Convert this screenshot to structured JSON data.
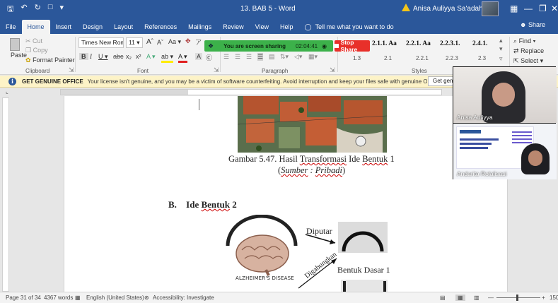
{
  "titlebar": {
    "doc_title": "13. BAB 5  -  Word",
    "user_name": "Anisa Auliyya Sa'adah",
    "qat": [
      "save-icon",
      "undo-icon",
      "redo-icon",
      "new-doc-icon",
      "qat-more-icon"
    ],
    "minimize": "—",
    "restore": "❐",
    "close": "✕"
  },
  "tabs": [
    "File",
    "Home",
    "Insert",
    "Design",
    "Layout",
    "References",
    "Mailings",
    "Review",
    "View",
    "Help"
  ],
  "active_tab": "Home",
  "tell_me": "Tell me what you want to do",
  "share_label": "Share",
  "clipboard": {
    "paste": "Paste",
    "cut": "Cut",
    "copy": "Copy",
    "format_painter": "Format Painter",
    "group_label": "Clipboard"
  },
  "font": {
    "name": "Times New Roma",
    "size": "11",
    "group_label": "Font"
  },
  "paragraph": {
    "group_label": "Paragraph"
  },
  "styles": {
    "group_label": "Styles",
    "items": [
      {
        "sample": "2.1.1. Aa",
        "name": "1.3"
      },
      {
        "sample": "2.2.1. Aa",
        "name": "2.1"
      },
      {
        "sample": "2.2.3.1.",
        "name": "2.2.1"
      },
      {
        "sample": "2.4.1.",
        "name": "2.2.3"
      },
      {
        "sample": "",
        "name": "2.3"
      }
    ]
  },
  "editing": {
    "find": "Find",
    "replace": "Replace",
    "select": "Select"
  },
  "screenshare": {
    "message": "You are screen sharing",
    "timer": "02:04:41",
    "stop": "Stop Share"
  },
  "banner": {
    "title": "GET GENUINE OFFICE",
    "message": "Your license isn't genuine, and you may be a victim of software counterfeiting. Avoid interruption and keep your files safe with genuine Office today.",
    "button": "Get genu"
  },
  "document": {
    "caption_prefix": "Gambar 5.47. Hasil ",
    "caption_word1": "Transformasi",
    "caption_mid": " Ide ",
    "caption_word2": "Bentuk",
    "caption_suffix": " 1",
    "source_open": "(",
    "source_word1": "Sumber",
    "source_mid": " : ",
    "source_word2": "Pribadi",
    "source_close": ")",
    "heading_letter": "B.",
    "heading_prefix": "Ide ",
    "heading_word": "Bentuk",
    "heading_suffix": " 2",
    "diagram_label_rotated": "Diputar",
    "diagram_label_tilted": "Digabungkan",
    "diagram_brain_caption": "ALZHEIMER'S DISEASE",
    "diagram_shape_label": "Bentuk Dasar 1"
  },
  "status": {
    "page": "Page 31 of 34",
    "words": "4367 words",
    "language": "English (United States)",
    "accessibility": "Accessibility: Investigate",
    "zoom": "150"
  },
  "video": {
    "participant1": "Anisa Auliyya",
    "participant2": "Andarita Rolalisasi"
  },
  "colors": {
    "word_blue": "#2b579a",
    "share_green": "#3cb14a",
    "stop_red": "#e8302a",
    "banner_yellow": "#fdf3c7"
  }
}
